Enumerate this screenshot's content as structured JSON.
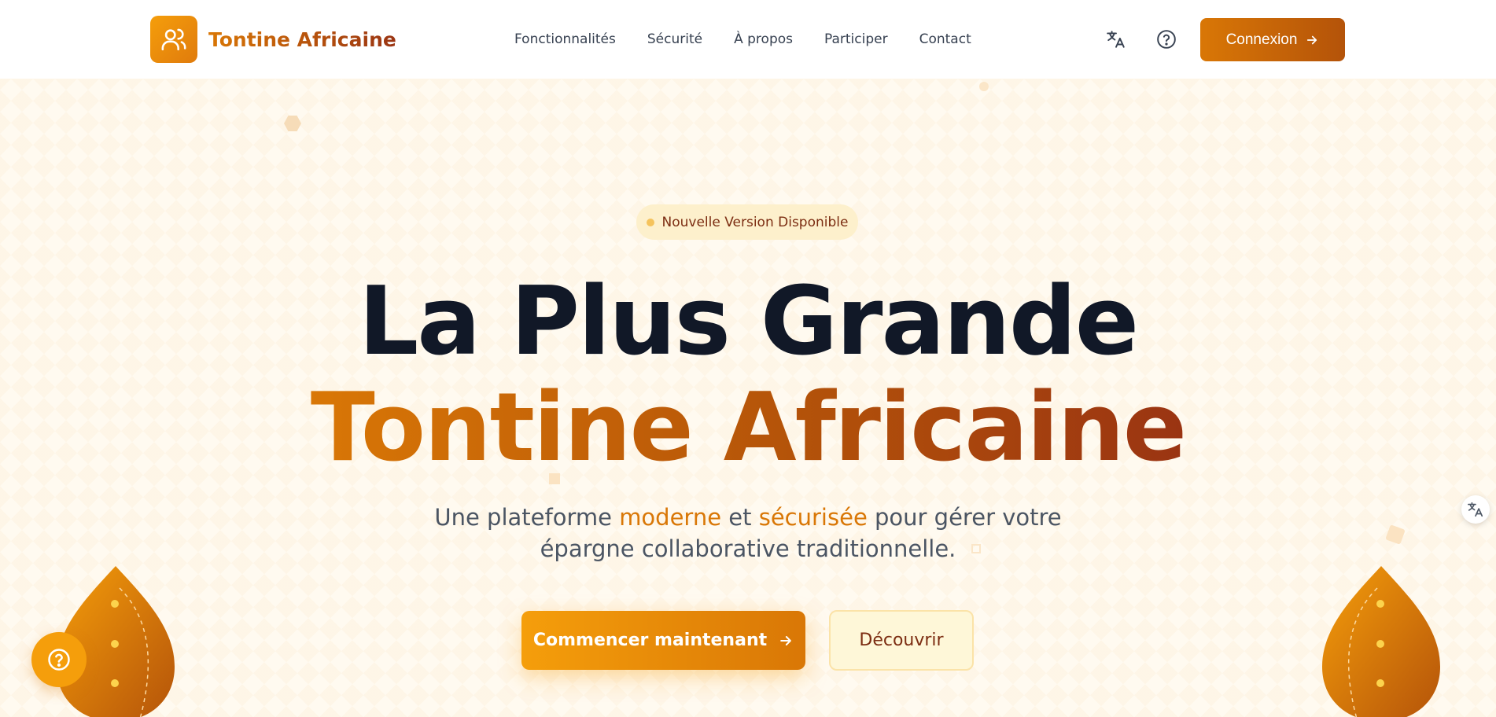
{
  "brand": {
    "name": "Tontine Africaine",
    "logo_icon": "users-icon"
  },
  "nav": {
    "links": [
      "Fonctionnalités",
      "Sécurité",
      "À propos",
      "Participer",
      "Contact"
    ],
    "translate_icon": "translate-icon",
    "help_icon": "help-circle-icon",
    "login_label": "Connexion"
  },
  "hero": {
    "badge": "Nouvelle Version Disponible",
    "headline_line1": "La Plus Grande",
    "headline_line2": "Tontine Africaine",
    "subtitle": {
      "part1": "Une plateforme ",
      "highlight1": "moderne",
      "part2": " et ",
      "highlight2": "sécurisée",
      "part3": " pour gérer votre",
      "line2": "épargne collaborative traditionnelle."
    },
    "cta_primary": "Commencer maintenant",
    "cta_secondary": "Découvrir"
  },
  "colors": {
    "accent": "#d97706",
    "accent_dark": "#9a3412",
    "badge_bg": "#fdf0cc",
    "heading": "#111827"
  }
}
